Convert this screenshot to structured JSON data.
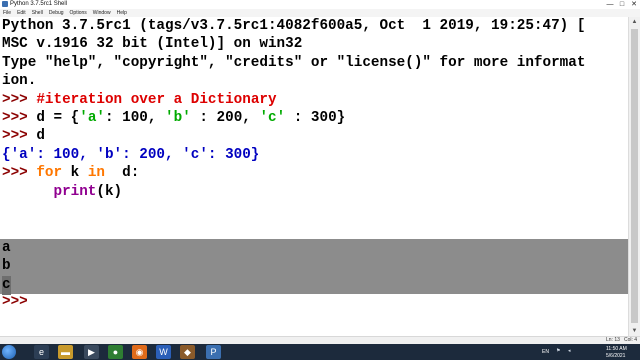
{
  "window": {
    "title": "Python 3.7.5rc1 Shell",
    "buttons": [
      "—",
      "□",
      "✕"
    ]
  },
  "menu": [
    "File",
    "Edit",
    "Shell",
    "Debug",
    "Options",
    "Window",
    "Help"
  ],
  "shell": {
    "banner": [
      "Python 3.7.5rc1 (tags/v3.7.5rc1:4082f600a5, Oct  1 2019, 19:25:47) [",
      "MSC v.1916 32 bit (Intel)] on win32",
      "Type \"help\", \"copyright\", \"credits\" or \"license()\" for more informat",
      "ion."
    ],
    "prompt": ">>> ",
    "comment": "#iteration over a Dictionary",
    "assign": {
      "pre": "d = {",
      "k1": "'a'",
      "v1": ": 100, ",
      "k2": "'b'",
      "v2": " : 200, ",
      "k3": "'c'",
      "v3": " : 300}"
    },
    "echo_cmd": "d",
    "echo_out": "{'a': 100, 'b': 200, 'c': 300}",
    "for_kw": "for",
    "for_var": " k ",
    "in_kw": "in",
    "for_tail": "  d:",
    "indent": "      ",
    "print_fn": "print",
    "print_args": "(k)",
    "outputs": [
      "a",
      "b",
      "c"
    ]
  },
  "status": {
    "line": "Ln: 13",
    "col": "Col: 4"
  },
  "taskbar": {
    "lang": "EN",
    "time": "11:50 AM",
    "date": "5/6/2021"
  },
  "colors": {
    "prompt": "#8b0000",
    "comment": "#dd0000",
    "keyword": "#ff7700",
    "builtin": "#900090",
    "string": "#00aa00",
    "stdout": "#0000c0",
    "output_bg": "#8c8c8c"
  }
}
